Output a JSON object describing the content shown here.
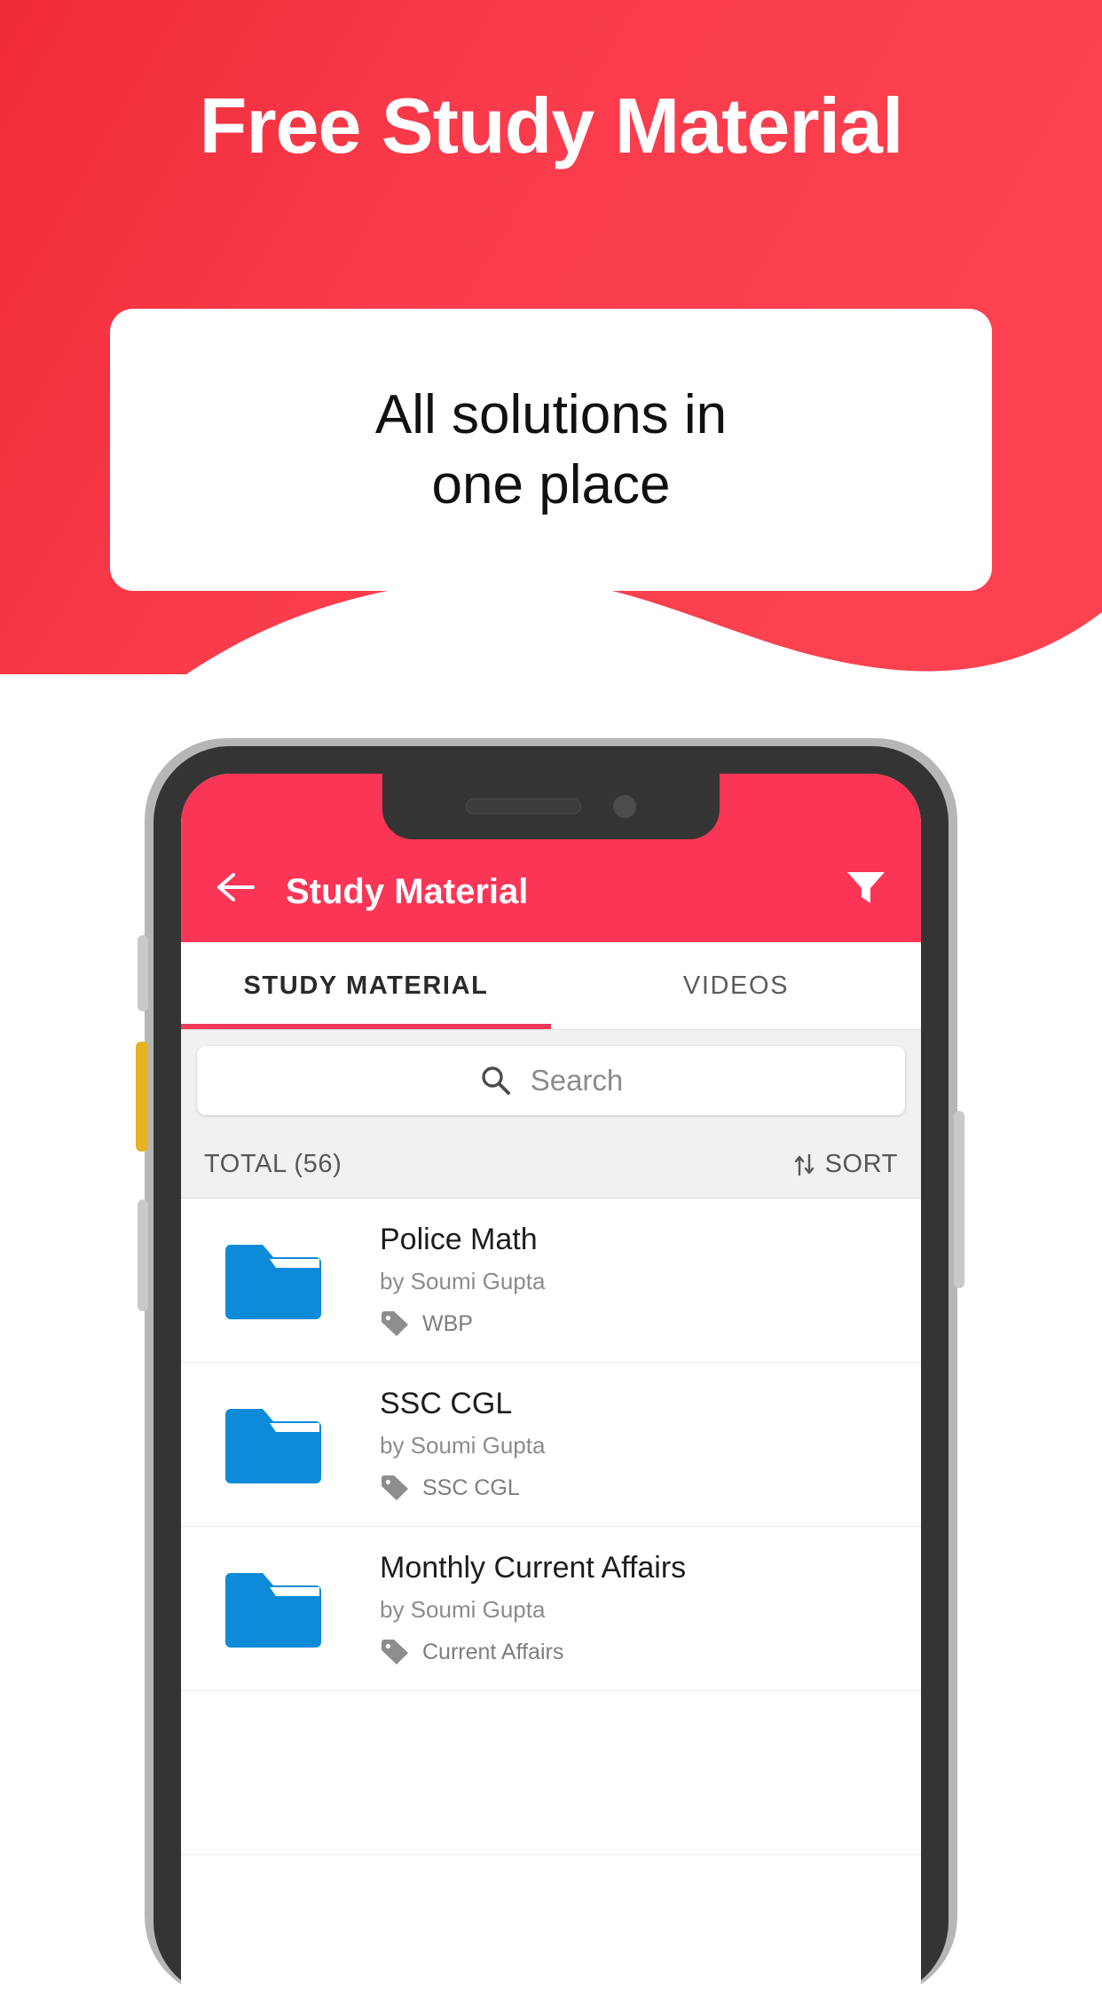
{
  "hero": {
    "title": "Free Study Material",
    "card_text_line1": "All solutions in",
    "card_text_line2": "one place",
    "bg_color": "#f9394b",
    "card_bg": "#ffffff"
  },
  "phone": {
    "frame_color": "#343434",
    "rim_color": "#b6b6b6"
  },
  "app": {
    "appbar": {
      "title": "Study Material",
      "bg_color": "#fa3556",
      "back_icon": "arrow-left-icon",
      "filter_icon": "filter-funnel-icon"
    },
    "tabs": [
      {
        "label": "STUDY MATERIAL",
        "active": true
      },
      {
        "label": "VIDEOS",
        "active": false
      }
    ],
    "tab_indicator_color": "#f33a5c",
    "search": {
      "placeholder": "Search",
      "value": "",
      "icon": "search-icon"
    },
    "toolbar": {
      "total_label": "TOTAL (56)",
      "sort_label": "SORT",
      "sort_icon": "sort-arrows-icon"
    },
    "list": [
      {
        "title": "Police Math",
        "author": "by Soumi Gupta",
        "tag": "WBP",
        "icon": "folder-icon",
        "icon_color": "#0d8bd9"
      },
      {
        "title": "SSC CGL",
        "author": "by Soumi Gupta",
        "tag": "SSC CGL",
        "icon": "folder-icon",
        "icon_color": "#0d8bd9"
      },
      {
        "title": "Monthly Current Affairs",
        "author": "by Soumi Gupta",
        "tag": "Current Affairs",
        "icon": "folder-icon",
        "icon_color": "#0d8bd9"
      }
    ]
  }
}
